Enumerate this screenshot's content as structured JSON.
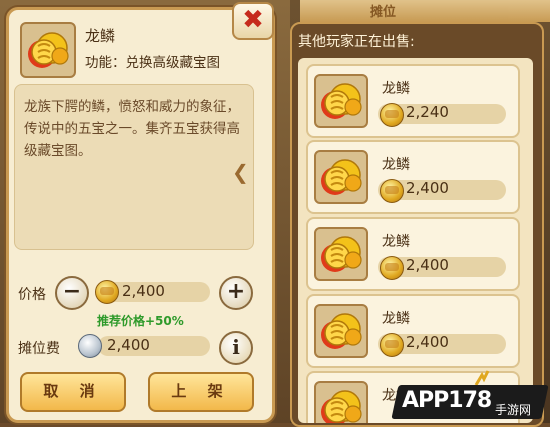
{
  "detail": {
    "item_name": "龙鳞",
    "item_function": "功能：兑换高级藏宝图",
    "description": "龙族下腭的鳞，愤怒和威力的象征，传说中的五宝之一。集齐五宝获得高级藏宝图。",
    "close_label": "✖",
    "price_label": "价格",
    "price_value": "2,400",
    "minus_label": "−",
    "plus_label": "+",
    "recommend_text": "推荐价格+50%",
    "booth_fee_label": "摊位费",
    "booth_fee_value": "2,400",
    "info_label": "i",
    "cancel_label": "取 消",
    "list_label": "上 架"
  },
  "market": {
    "header": "其他玩家正在出售:",
    "listings": [
      {
        "name": "龙鳞",
        "price": "2,240"
      },
      {
        "name": "龙鳞",
        "price": "2,400"
      },
      {
        "name": "龙鳞",
        "price": "2,400"
      },
      {
        "name": "龙鳞",
        "price": "2,400"
      },
      {
        "name": "龙鳞",
        "price": ""
      }
    ]
  },
  "watermark": {
    "text": "APP178",
    "sub": "手游网"
  },
  "colors": {
    "gold": "#e0a820",
    "recommend": "#2e9a2a",
    "close": "#c62a1c"
  }
}
